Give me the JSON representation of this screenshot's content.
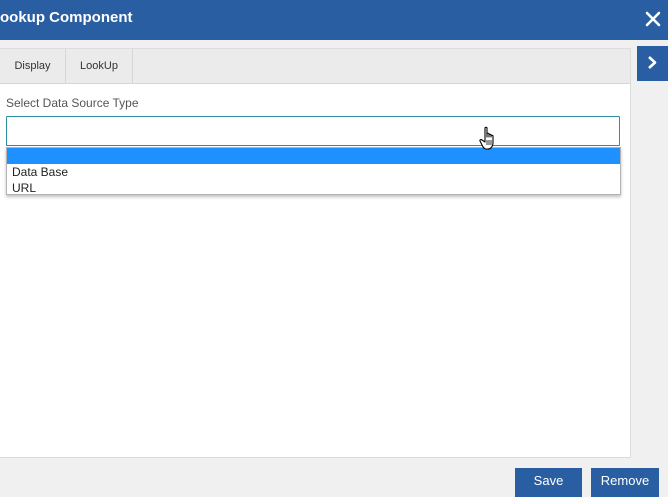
{
  "dialog": {
    "title": "ookup Component",
    "close_icon": "close-icon"
  },
  "tabs": [
    {
      "label": "Display"
    },
    {
      "label": "LookUp"
    }
  ],
  "form": {
    "source_type_label": "Select Data Source Type",
    "source_type_value": "",
    "options": [
      {
        "label": "",
        "selected": true
      },
      {
        "label": "Data Base",
        "selected": false
      },
      {
        "label": "URL",
        "selected": false
      }
    ]
  },
  "side_toggle": {
    "icon": "chevron-right-icon"
  },
  "footer": {
    "save_label": "Save",
    "remove_label": "Remove"
  },
  "colors": {
    "brand": "#2a5ea2",
    "selected_option": "#1e90ff",
    "focus_border": "#2f8ea0"
  }
}
